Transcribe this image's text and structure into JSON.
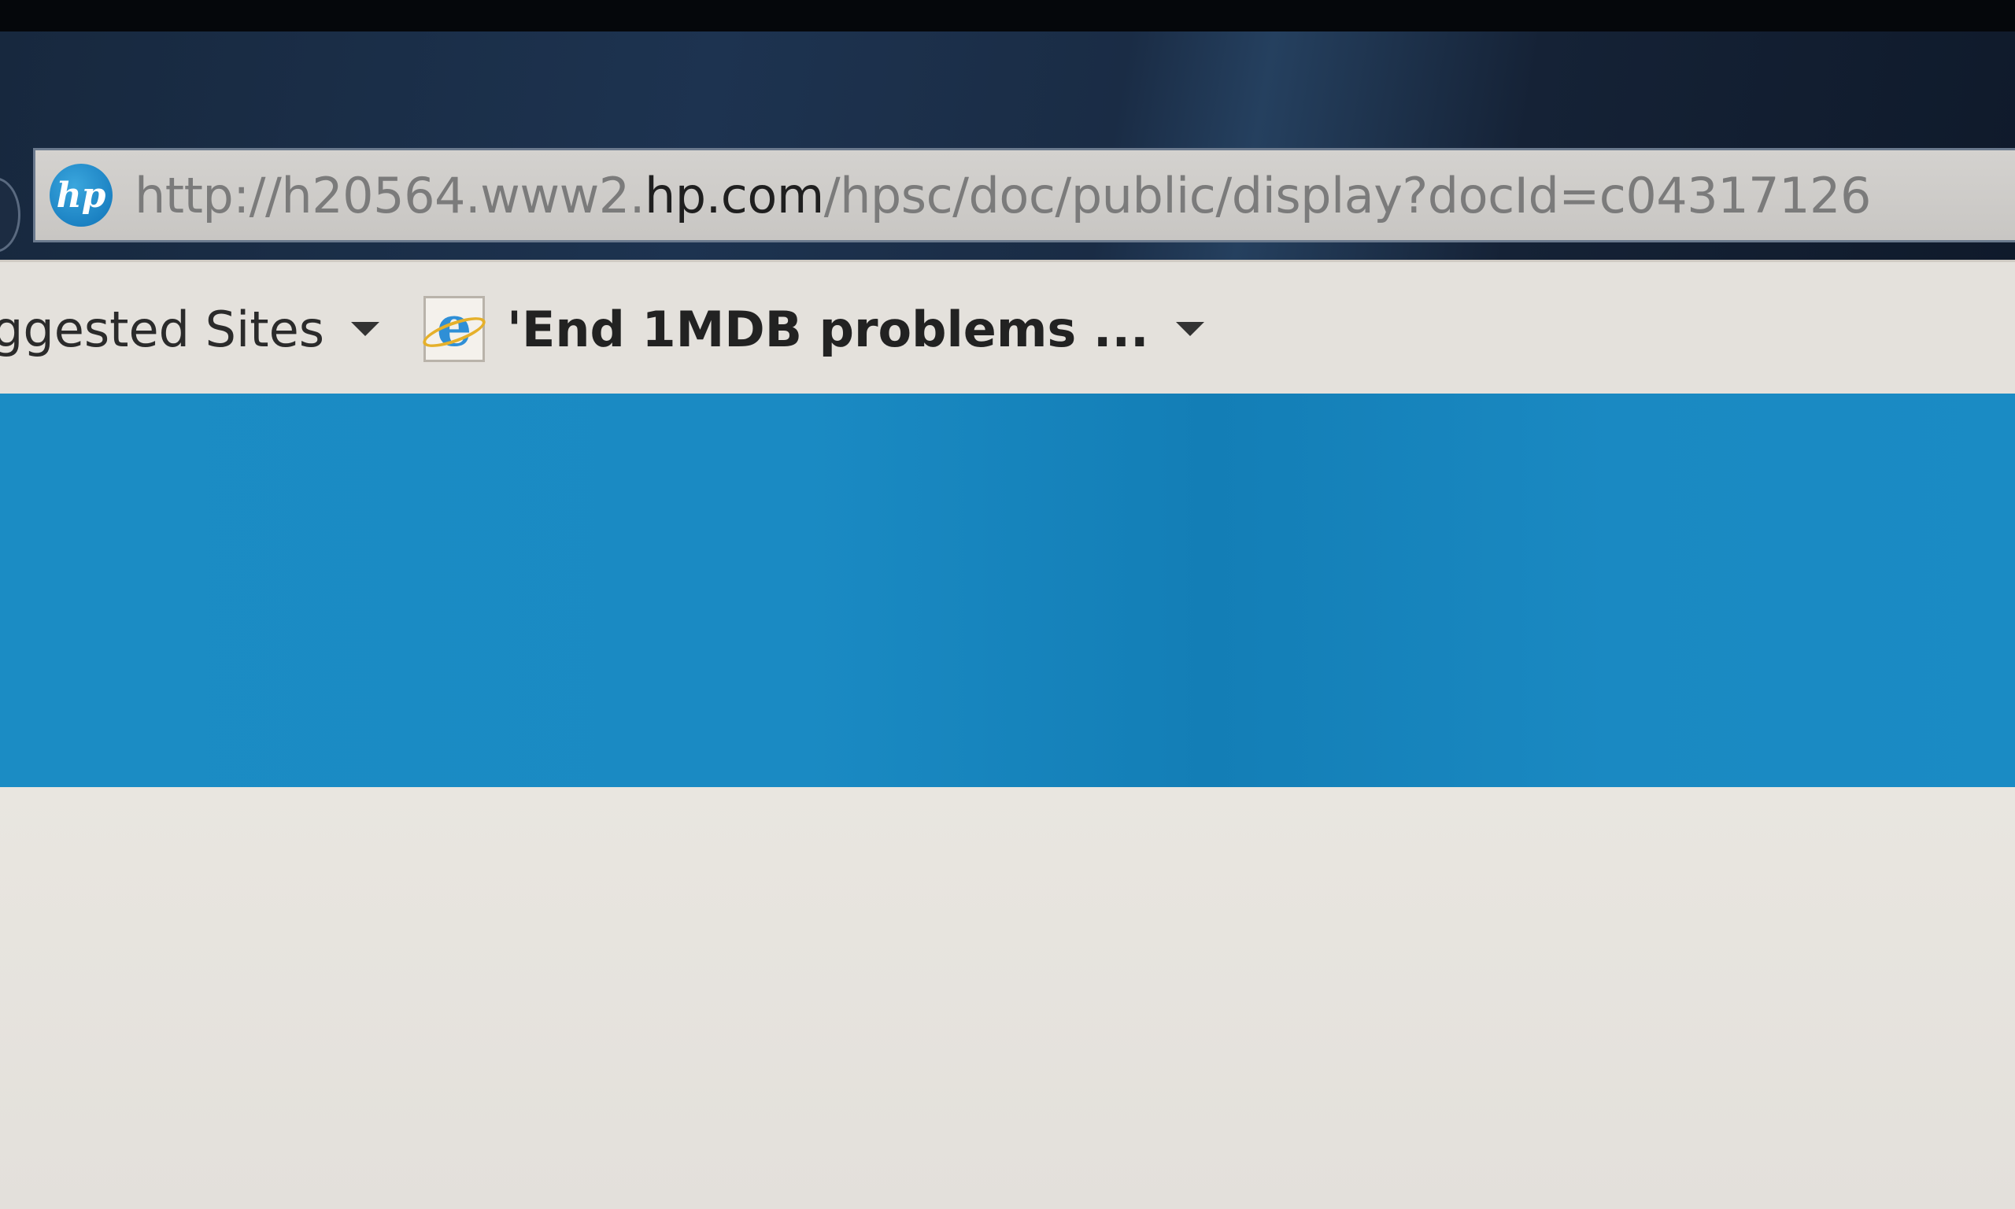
{
  "browser": {
    "address_bar": {
      "url_prefix": "http://h20564.www2.",
      "url_domain": "hp.com",
      "url_path": "/hpsc/doc/public/display?docId=c04317126",
      "site_icon": "hp-logo-icon"
    },
    "favorites_bar": {
      "items": [
        {
          "label": "ggested Sites",
          "icon": "none",
          "has_dropdown": true
        },
        {
          "label": "'End 1MDB problems ...",
          "icon": "ie-page-icon",
          "has_dropdown": true
        }
      ]
    }
  },
  "page": {
    "banner_color": "#1a8ac3",
    "background_color": "#e6e3de"
  }
}
